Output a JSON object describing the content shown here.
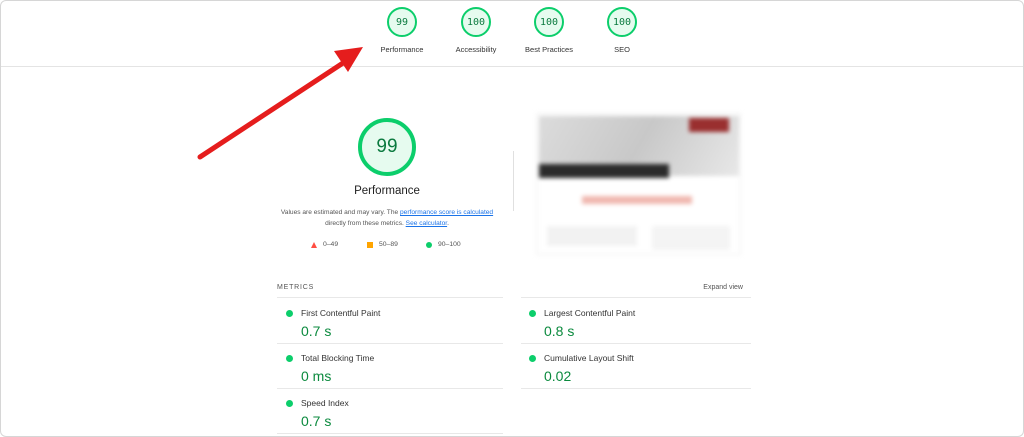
{
  "categories": [
    {
      "score": "99",
      "label": "Performance"
    },
    {
      "score": "100",
      "label": "Accessibility"
    },
    {
      "score": "100",
      "label": "Best Practices"
    },
    {
      "score": "100",
      "label": "SEO"
    }
  ],
  "main": {
    "score": "99",
    "title": "Performance",
    "note_prefix": "Values are estimated and may vary. The ",
    "note_link": "performance score is calculated",
    "note_middle": " directly from these metrics. ",
    "note_calc": "See calculator",
    "note_suffix": "."
  },
  "legend": [
    {
      "shape": "triangle",
      "label": "0–49",
      "color": "#ff4e42"
    },
    {
      "shape": "square",
      "label": "50–89",
      "color": "#ffa400"
    },
    {
      "shape": "circle",
      "label": "90–100",
      "color": "#0cce6b"
    }
  ],
  "metrics": {
    "heading": "METRICS",
    "expand_label": "Expand view",
    "items": [
      {
        "name": "First Contentful Paint",
        "value": "0.7 s"
      },
      {
        "name": "Largest Contentful Paint",
        "value": "0.8 s"
      },
      {
        "name": "Total Blocking Time",
        "value": "0 ms"
      },
      {
        "name": "Cumulative Layout Shift",
        "value": "0.02"
      },
      {
        "name": "Speed Index",
        "value": "0.7 s"
      }
    ]
  },
  "colors": {
    "pass": "#0cce6b",
    "average": "#ffa400",
    "fail": "#ff4e42",
    "annotation_arrow": "#e51d1d"
  }
}
